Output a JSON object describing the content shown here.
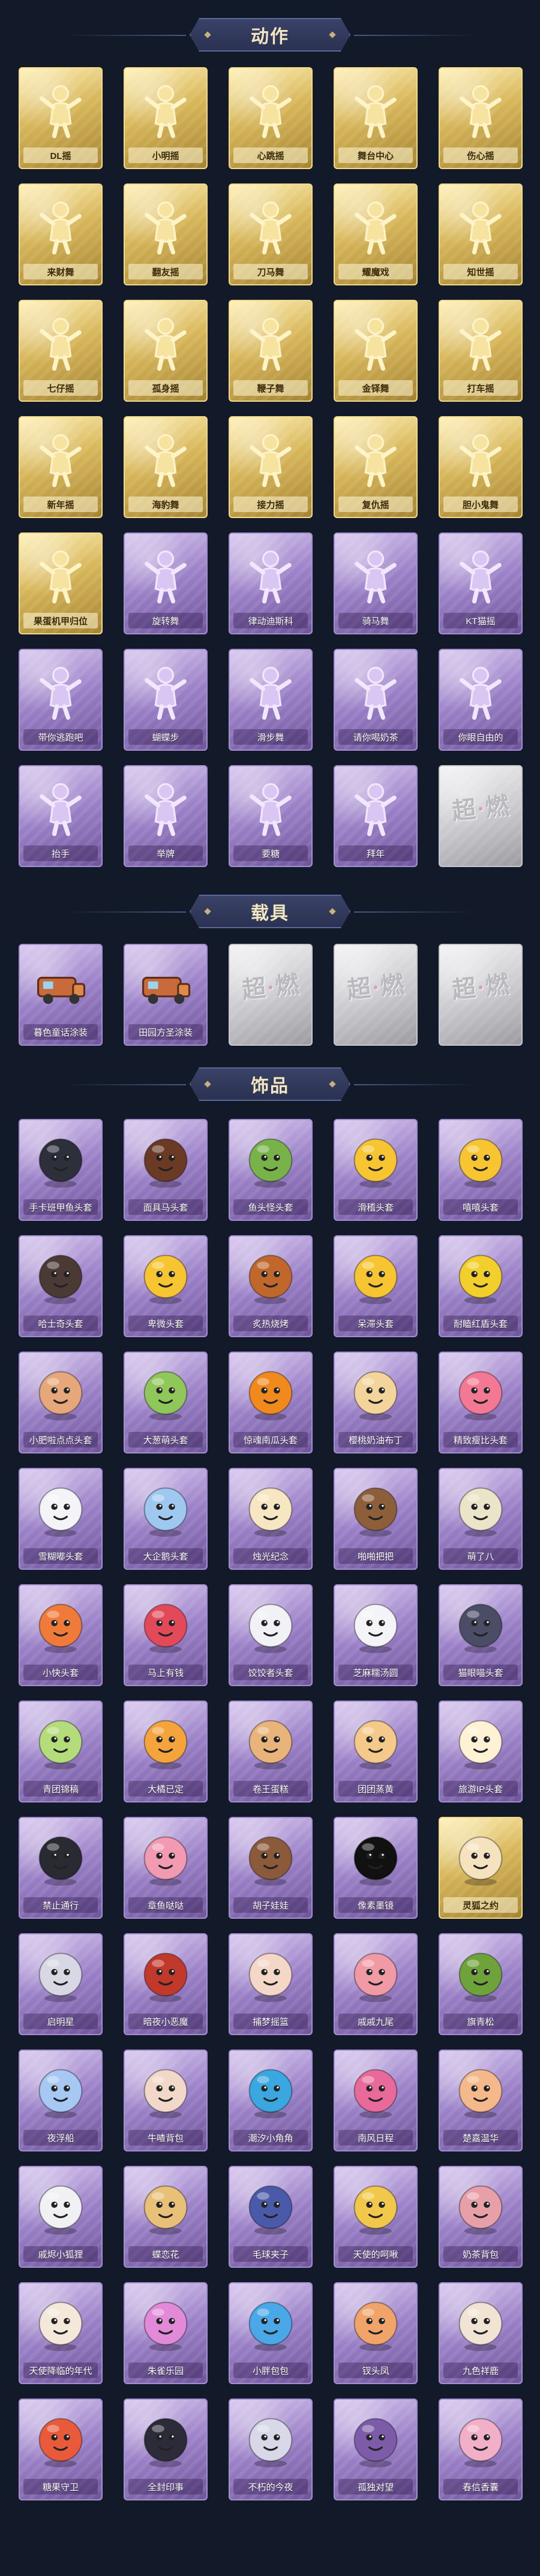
{
  "sections": {
    "actions": {
      "title": "动作"
    },
    "vehicles": {
      "title": "载具"
    },
    "accessories": {
      "title": "饰品"
    }
  },
  "colors": {
    "gold_card": "#d8b75a",
    "purple_card": "#9a80c7",
    "locked_card": "#c8c8cc",
    "background": "#121a2a"
  },
  "locked_mark": "超燃",
  "actions": [
    {
      "label": "DL摇",
      "style": "gold",
      "icon": "dance-pose-icon"
    },
    {
      "label": "小明摇",
      "style": "gold",
      "icon": "dance-pose-icon"
    },
    {
      "label": "心跳摇",
      "style": "gold",
      "icon": "dance-pose-icon"
    },
    {
      "label": "舞台中心",
      "style": "gold",
      "icon": "dance-pose-icon"
    },
    {
      "label": "伤心摇",
      "style": "gold",
      "icon": "dance-pose-icon"
    },
    {
      "label": "来财舞",
      "style": "gold",
      "icon": "dance-pose-icon"
    },
    {
      "label": "翻友摇",
      "style": "gold",
      "icon": "dance-pose-icon"
    },
    {
      "label": "刀马舞",
      "style": "gold",
      "icon": "dance-pose-icon"
    },
    {
      "label": "耀魔戏",
      "style": "gold",
      "icon": "dance-pose-icon"
    },
    {
      "label": "知世摇",
      "style": "gold",
      "icon": "dance-pose-icon"
    },
    {
      "label": "七仔摇",
      "style": "gold",
      "icon": "dance-pose-icon"
    },
    {
      "label": "孤身摇",
      "style": "gold",
      "icon": "dance-pose-icon"
    },
    {
      "label": "鞭子舞",
      "style": "gold",
      "icon": "dance-pose-icon"
    },
    {
      "label": "金铎舞",
      "style": "gold",
      "icon": "dance-pose-icon"
    },
    {
      "label": "打车摇",
      "style": "gold",
      "icon": "dance-pose-icon"
    },
    {
      "label": "新年摇",
      "style": "gold",
      "icon": "dance-pose-icon"
    },
    {
      "label": "海豹舞",
      "style": "gold",
      "icon": "dance-pose-icon"
    },
    {
      "label": "接力摇",
      "style": "gold",
      "icon": "dance-pose-icon"
    },
    {
      "label": "复仇摇",
      "style": "gold",
      "icon": "dance-pose-icon"
    },
    {
      "label": "胆小鬼舞",
      "style": "gold",
      "icon": "dance-pose-icon"
    },
    {
      "label": "果蛋机甲归位",
      "style": "gold",
      "icon": "dance-pose-icon"
    },
    {
      "label": "旋转舞",
      "style": "purple",
      "icon": "dance-pose-icon"
    },
    {
      "label": "律动迪斯科",
      "style": "purple",
      "icon": "dance-pose-icon"
    },
    {
      "label": "骑马舞",
      "style": "purple",
      "icon": "dance-pose-icon"
    },
    {
      "label": "KT猫摇",
      "style": "purple",
      "icon": "dance-pose-icon"
    },
    {
      "label": "带你逃跑吧",
      "style": "purple",
      "icon": "dance-pose-icon"
    },
    {
      "label": "蝴蝶步",
      "style": "purple",
      "icon": "dance-pose-icon"
    },
    {
      "label": "滑步舞",
      "style": "purple",
      "icon": "dance-pose-icon"
    },
    {
      "label": "请你喝奶茶",
      "style": "purple",
      "icon": "dance-pose-icon"
    },
    {
      "label": "你眼自由的",
      "style": "purple",
      "icon": "dance-pose-icon"
    },
    {
      "label": "抬手",
      "style": "purple",
      "icon": "dance-pose-icon"
    },
    {
      "label": "举牌",
      "style": "purple",
      "icon": "dance-pose-icon"
    },
    {
      "label": "要糖",
      "style": "purple",
      "icon": "dance-pose-icon"
    },
    {
      "label": "拜年",
      "style": "purple",
      "icon": "dance-pose-icon"
    },
    {
      "label": "",
      "style": "locked",
      "icon": "locked-card-icon"
    }
  ],
  "vehicles": [
    {
      "label": "暮色童话涂装",
      "style": "purple",
      "icon": "vehicle-icon"
    },
    {
      "label": "田园方圣涂装",
      "style": "purple",
      "icon": "vehicle-icon"
    },
    {
      "label": "",
      "style": "locked",
      "icon": "locked-card-icon"
    },
    {
      "label": "",
      "style": "locked",
      "icon": "locked-card-icon"
    },
    {
      "label": "",
      "style": "locked",
      "icon": "locked-card-icon"
    }
  ],
  "accessories": [
    {
      "label": "手卡班甲鱼头套",
      "style": "purple",
      "icon": "penguin-head-icon",
      "tint": "#2d2f3a"
    },
    {
      "label": "面具马头套",
      "style": "purple",
      "icon": "horse-head-icon",
      "tint": "#6b3a24"
    },
    {
      "label": "鱼头怪头套",
      "style": "purple",
      "icon": "fish-head-icon",
      "tint": "#78b34a"
    },
    {
      "label": "滑稽头套",
      "style": "purple",
      "icon": "smile-face-icon",
      "tint": "#f7c531"
    },
    {
      "label": "嘻嘻头套",
      "style": "purple",
      "icon": "grin-face-icon",
      "tint": "#f7c531"
    },
    {
      "label": "哈士奇头套",
      "style": "purple",
      "icon": "husky-head-icon",
      "tint": "#4a3a33"
    },
    {
      "label": "卑微头套",
      "style": "purple",
      "icon": "sad-face-icon",
      "tint": "#f7c531"
    },
    {
      "label": "炙热烧烤",
      "style": "purple",
      "icon": "toast-head-icon",
      "tint": "#c0672b"
    },
    {
      "label": "呆滞头套",
      "style": "purple",
      "icon": "dazed-face-icon",
      "tint": "#f7c531"
    },
    {
      "label": "耐瞌红盾头套",
      "style": "purple",
      "icon": "pikachu-head-icon",
      "tint": "#f2cf2a"
    },
    {
      "label": "小肥啦点点头套",
      "style": "purple",
      "icon": "blob-head-icon",
      "tint": "#e6a87a"
    },
    {
      "label": "大葱萌头套",
      "style": "purple",
      "icon": "cabbage-head-icon",
      "tint": "#8fc75a"
    },
    {
      "label": "惊魂南瓜头套",
      "style": "purple",
      "icon": "pumpkin-head-icon",
      "tint": "#f08a1d"
    },
    {
      "label": "樱桃奶油布丁",
      "style": "purple",
      "icon": "pudding-head-icon",
      "tint": "#f3d49a"
    },
    {
      "label": "精致瘦比头套",
      "style": "purple",
      "icon": "pink-blob-icon",
      "tint": "#f27893"
    },
    {
      "label": "雪糊嘟头套",
      "style": "purple",
      "icon": "snow-cap-icon",
      "tint": "#f4f4f8"
    },
    {
      "label": "大企鹅头套",
      "style": "purple",
      "icon": "round-bird-icon",
      "tint": "#9fc8f0"
    },
    {
      "label": "烛光纪念",
      "style": "purple",
      "icon": "candle-icon",
      "tint": "#f7e6c2"
    },
    {
      "label": "啪啪把把",
      "style": "purple",
      "icon": "dog-head-icon",
      "tint": "#8d5e3a"
    },
    {
      "label": "萌了八",
      "style": "purple",
      "icon": "garlic-head-icon",
      "tint": "#eae4c8"
    },
    {
      "label": "小快头套",
      "style": "purple",
      "icon": "tv-head-icon",
      "tint": "#f07a3a"
    },
    {
      "label": "马上有钱",
      "style": "purple",
      "icon": "red-bird-icon",
      "tint": "#e24a5a"
    },
    {
      "label": "饺饺者头套",
      "style": "purple",
      "icon": "dumpling-head-icon",
      "tint": "#f2f2f6"
    },
    {
      "label": "芝麻糯汤圆",
      "style": "purple",
      "icon": "rice-ball-icon",
      "tint": "#f4f4f8"
    },
    {
      "label": "猫眼喵头套",
      "style": "purple",
      "icon": "cat-head-icon",
      "tint": "#4b4c66"
    },
    {
      "label": "青团锦稿",
      "style": "purple",
      "icon": "green-bun-icon",
      "tint": "#b4dc7a"
    },
    {
      "label": "大橘已定",
      "style": "purple",
      "icon": "orange-face-icon",
      "tint": "#f4a43a"
    },
    {
      "label": "卷王蛋糕",
      "style": "purple",
      "icon": "cake-roll-icon",
      "tint": "#e8b47a"
    },
    {
      "label": "团团蒸黄",
      "style": "purple",
      "icon": "bun-face-icon",
      "tint": "#f5c98a"
    },
    {
      "label": "旅游IP头套",
      "style": "purple",
      "icon": "duck-head-icon",
      "tint": "#fff2d4"
    },
    {
      "label": "禁止通行",
      "style": "purple",
      "icon": "traffic-cone-icon",
      "tint": "#2a2a33"
    },
    {
      "label": "章鱼哒哒",
      "style": "purple",
      "icon": "octopus-head-icon",
      "tint": "#f19ab2"
    },
    {
      "label": "胡子娃娃",
      "style": "purple",
      "icon": "doll-head-icon",
      "tint": "#8a5a3a"
    },
    {
      "label": "像素墨镜",
      "style": "purple",
      "icon": "pixel-glasses-icon",
      "tint": "#111111"
    },
    {
      "label": "灵狐之约",
      "style": "gold",
      "icon": "fox-mask-icon",
      "tint": "#f5e3c0"
    },
    {
      "label": "启明星",
      "style": "purple",
      "icon": "star-hair-icon",
      "tint": "#d8d8e4"
    },
    {
      "label": "暗夜小恶魔",
      "style": "purple",
      "icon": "devil-horns-icon",
      "tint": "#c0392b"
    },
    {
      "label": "捕梦摇篮",
      "style": "purple",
      "icon": "dream-catcher-icon",
      "tint": "#f4d7c6"
    },
    {
      "label": "戚戚九尾",
      "style": "purple",
      "icon": "nine-tail-icon",
      "tint": "#f09aa6"
    },
    {
      "label": "旗青松",
      "style": "purple",
      "icon": "bonsai-icon",
      "tint": "#6ea23a"
    },
    {
      "label": "夜浮船",
      "style": "purple",
      "icon": "ice-crystal-icon",
      "tint": "#a8c8f4"
    },
    {
      "label": "牛喳背包",
      "style": "purple",
      "icon": "cow-backpack-icon",
      "tint": "#f2d8c8"
    },
    {
      "label": "潮汐小角角",
      "style": "purple",
      "icon": "blue-cat-icon",
      "tint": "#3aa7e0"
    },
    {
      "label": "南风日程",
      "style": "purple",
      "icon": "capsule-icon",
      "tint": "#e86a9a"
    },
    {
      "label": "楚嘉温华",
      "style": "purple",
      "icon": "flower-doll-icon",
      "tint": "#f4b88a"
    },
    {
      "label": "戚烬小狐狸",
      "style": "purple",
      "icon": "white-fox-icon",
      "tint": "#f1f1f4"
    },
    {
      "label": "蝶恋花",
      "style": "purple",
      "icon": "butterfly-icon",
      "tint": "#e8c078"
    },
    {
      "label": "毛球夹子",
      "style": "purple",
      "icon": "soldier-doll-icon",
      "tint": "#4a5aa8"
    },
    {
      "label": "天使的呵啾",
      "style": "purple",
      "icon": "angel-doll-icon",
      "tint": "#f2c84a"
    },
    {
      "label": "奶茶背包",
      "style": "purple",
      "icon": "milk-tea-bag-icon",
      "tint": "#e8a0a8"
    },
    {
      "label": "天使降临的年代",
      "style": "purple",
      "icon": "angel-wing-icon",
      "tint": "#f4e8da"
    },
    {
      "label": "朱雀乐园",
      "style": "purple",
      "icon": "pink-castle-icon",
      "tint": "#e28ad8"
    },
    {
      "label": "小胖包包",
      "style": "purple",
      "icon": "blue-bird-bag-icon",
      "tint": "#4aa8e8"
    },
    {
      "label": "钗头凤",
      "style": "purple",
      "icon": "phoenix-pin-icon",
      "tint": "#f0a46a"
    },
    {
      "label": "九色祥鹿",
      "style": "purple",
      "icon": "deer-charm-icon",
      "tint": "#f2e4d4"
    },
    {
      "label": "糖果守卫",
      "style": "purple",
      "icon": "candy-guard-icon",
      "tint": "#e85a3a"
    },
    {
      "label": "全封印事",
      "style": "purple",
      "icon": "dark-doll-icon",
      "tint": "#2b2b3a"
    },
    {
      "label": "不朽的今夜",
      "style": "purple",
      "icon": "wind-chime-icon",
      "tint": "#d8d8e8"
    },
    {
      "label": "孤独对望",
      "style": "purple",
      "icon": "girl-doll-icon",
      "tint": "#7c5ca8"
    },
    {
      "label": "春信香囊",
      "style": "purple",
      "icon": "sachet-charm-icon",
      "tint": "#f2b0c8"
    }
  ]
}
